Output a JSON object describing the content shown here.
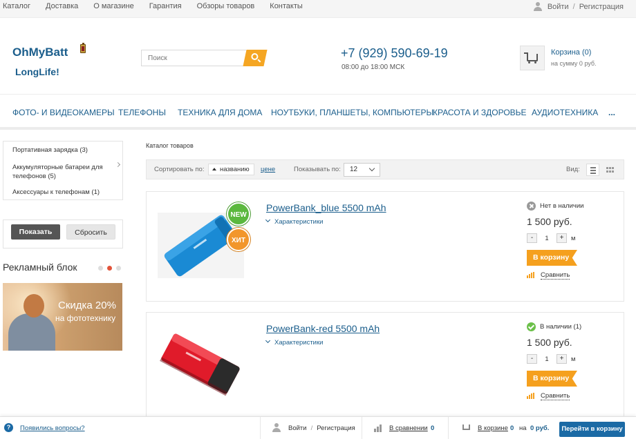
{
  "topbar": {
    "nav": [
      "Каталог",
      "Доставка",
      "О магазине",
      "Гарантия",
      "Обзоры товаров",
      "Контакты"
    ],
    "login": "Войти",
    "sep": "/",
    "register": "Регистрация"
  },
  "header": {
    "logo_title": "OhMyBatt",
    "logo_subtitle": "LongLife!",
    "search_placeholder": "Поиск",
    "phone": "+7 (929) 590-69-19",
    "hours": "08:00 до 18:00 МСК",
    "cart_title": "Корзина (0)",
    "cart_sum": "на сумму 0 руб."
  },
  "mainmenu": [
    "Фото- и видеокамеры",
    "Телефоны",
    "Техника для дома",
    "Ноутбуки, планшеты, компьютеры",
    "Красота и здоровье",
    "Аудиотехника",
    "..."
  ],
  "sidebar": {
    "categories": [
      "Портативная зарядка (3)",
      "Аккумуляторные батареи для телефонов (5)",
      "Аксессуары к телефонам (1)"
    ],
    "show_button": "Показать",
    "reset_button": "Сбросить",
    "ad_title": "Рекламный блок",
    "banner_line1": "Скидка 20%",
    "banner_line2": "на фототехнику"
  },
  "catalog": {
    "breadcrumb": "Каталог товаров",
    "sort_label": "Сортировать по:",
    "sort_name": "названию",
    "sort_price": "цене",
    "perpage_label": "Показывать по:",
    "perpage_value": "12",
    "view_label": "Вид:"
  },
  "products": [
    {
      "name": "PowerBank_blue 5500 mAh",
      "characteristics": "Характеристики",
      "stock": "Нет в наличии",
      "in_stock": false,
      "price": "1 500 руб.",
      "qty": "1",
      "unit": "м",
      "to_cart": "В корзину",
      "compare": "Сравнить",
      "badges": [
        "NEW",
        "ХИТ"
      ],
      "color": "#1a8ad4"
    },
    {
      "name": "PowerBank-red 5500 mAh",
      "characteristics": "Характеристики",
      "stock": "В наличии (1)",
      "in_stock": true,
      "price": "1 500 руб.",
      "qty": "1",
      "unit": "м",
      "to_cart": "В корзину",
      "compare": "Сравнить",
      "badges": [],
      "color": "#e01b2a"
    }
  ],
  "qty_minus": "-",
  "qty_plus": "+",
  "bottombar": {
    "question_icon": "?",
    "questions": "Появились вопросы?",
    "login": "Войти",
    "sep": "/",
    "register": "Регистрация",
    "compare_label": "В сравнении",
    "compare_count": "0",
    "cart_label": "В корзине",
    "cart_count": "0",
    "on": "на",
    "cart_sum": "0 руб.",
    "go_to_cart": "Перейти в корзину"
  },
  "colors": {
    "brand_blue": "#1b5e8c",
    "accent_orange": "#f5a01e",
    "button_blue": "#1b6aa5"
  }
}
